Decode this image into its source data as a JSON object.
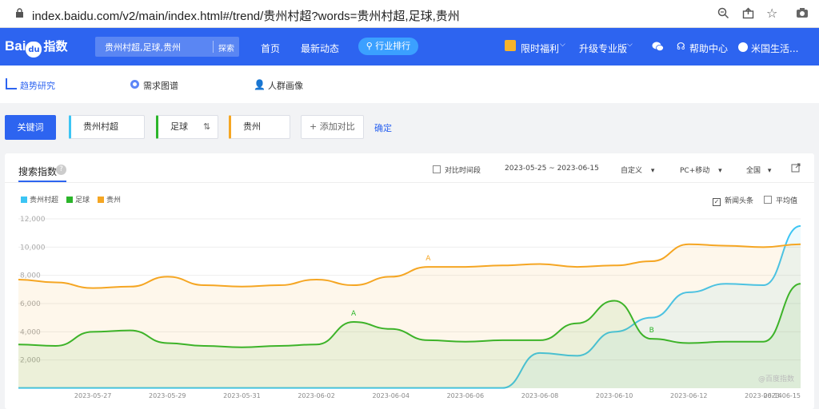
{
  "browser": {
    "url": "index.baidu.com/v2/main/index.html#/trend/贵州村超?words=贵州村超,足球,贵州"
  },
  "nav": {
    "logo_left": "Bai",
    "logo_mid": "du",
    "logo_right": "指数",
    "search_value": "贵州村超,足球,贵州",
    "search_btn": "探索",
    "home": "首页",
    "news": "最新动态",
    "rank": "行业排行",
    "welfare": "限时福利",
    "upgrade": "升级专业版",
    "help": "帮助中心",
    "user": "米国生活..."
  },
  "subnav": {
    "trend": "趋势研究",
    "demand": "需求图谱",
    "crowd": "人群画像"
  },
  "compare": {
    "keyword_btn": "关键词",
    "k1": "贵州村超",
    "k2": "足球",
    "k3": "贵州",
    "add": "+ 添加对比",
    "confirm": "确定"
  },
  "card": {
    "title": "搜索指数",
    "compare_period": "对比时间段",
    "date_range": "2023-05-25 ~ 2023-06-15",
    "custom": "自定义",
    "device": "PC+移动",
    "region": "全国",
    "news_heads": "新闻头条",
    "average": "平均值",
    "watermark": "@百度指数"
  },
  "colors": {
    "s1": "#3cc5f4",
    "s2": "#2bb52a",
    "s3": "#f5a623",
    "brand": "#2d64f0"
  },
  "chart_data": {
    "type": "area",
    "ylim": [
      0,
      12000
    ],
    "y_ticks": [
      "12,000",
      "10,000",
      "8,000",
      "6,000",
      "4,000",
      "2,000"
    ],
    "x_ticks": [
      "2023-05-27",
      "2023-05-29",
      "2023-05-31",
      "2023-06-02",
      "2023-06-04",
      "2023-06-06",
      "2023-06-08",
      "2023-06-10",
      "2023-06-12",
      "2023-06-14",
      "2023-06-15"
    ],
    "x": [
      "2023-05-25",
      "2023-05-26",
      "2023-05-27",
      "2023-05-28",
      "2023-05-29",
      "2023-05-30",
      "2023-05-31",
      "2023-06-01",
      "2023-06-02",
      "2023-06-03",
      "2023-06-04",
      "2023-06-05",
      "2023-06-06",
      "2023-06-07",
      "2023-06-08",
      "2023-06-09",
      "2023-06-10",
      "2023-06-11",
      "2023-06-12",
      "2023-06-13",
      "2023-06-14",
      "2023-06-15"
    ],
    "series": [
      {
        "name": "贵州村超",
        "color": "#3cc5f4",
        "values": [
          20,
          20,
          20,
          20,
          20,
          20,
          20,
          20,
          20,
          20,
          20,
          20,
          20,
          20,
          2500,
          2300,
          4000,
          5000,
          6800,
          7400,
          7300,
          11500
        ]
      },
      {
        "name": "足球",
        "color": "#2bb52a",
        "values": [
          3100,
          3000,
          4000,
          4100,
          3200,
          3000,
          2900,
          3000,
          3100,
          4700,
          4200,
          3400,
          3300,
          3400,
          3400,
          4600,
          6200,
          3500,
          3200,
          3300,
          3300,
          7400
        ]
      },
      {
        "name": "贵州",
        "color": "#f5a623",
        "values": [
          7700,
          7500,
          7100,
          7200,
          7900,
          7300,
          7200,
          7300,
          7700,
          7300,
          7900,
          8600,
          8600,
          8700,
          8800,
          8600,
          8700,
          9000,
          10200,
          10100,
          10000,
          10200
        ]
      }
    ],
    "annotations": [
      {
        "series": "贵州",
        "date": "2023-06-05",
        "label": "A"
      },
      {
        "series": "足球",
        "date": "2023-06-03",
        "label": "A"
      },
      {
        "series": "足球",
        "date": "2023-06-11",
        "label": "B"
      }
    ],
    "legend": "top-left"
  }
}
